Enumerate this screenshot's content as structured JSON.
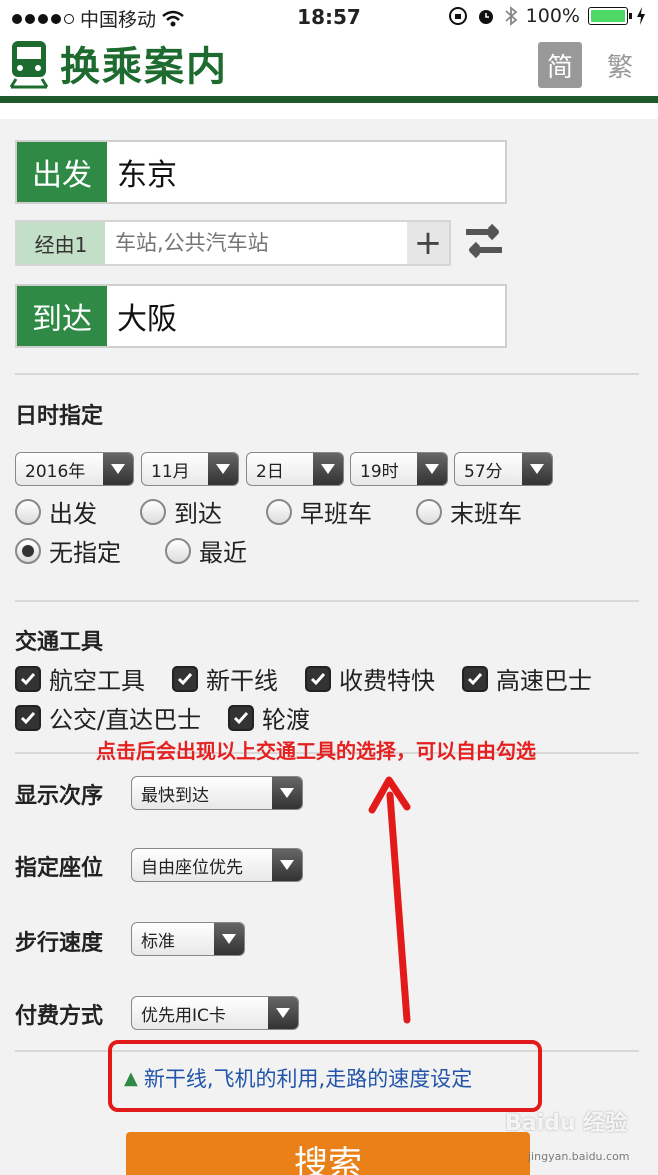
{
  "status_bar": {
    "carrier": "中国移动",
    "time": "18:57",
    "battery": "100%"
  },
  "header": {
    "title": "换乘案内",
    "lang_simplified": "简",
    "lang_traditional": "繁"
  },
  "route": {
    "from_label": "出发",
    "from_value": "东京",
    "via_label": "经由1",
    "via_placeholder": "车站,公共汽车站",
    "via_add": "+",
    "to_label": "到达",
    "to_value": "大阪"
  },
  "datetime": {
    "title": "日时指定",
    "year": "2016年",
    "month": "11月",
    "day": "2日",
    "hour": "19时",
    "minute": "57分",
    "options": [
      "出发",
      "到达",
      "早班车",
      "末班车",
      "无指定",
      "最近"
    ],
    "selected": "无指定"
  },
  "transport": {
    "title": "交通工具",
    "items": [
      "航空工具",
      "新干线",
      "收费特快",
      "高速巴士",
      "公交/直达巴士",
      "轮渡"
    ],
    "checked": [
      true,
      true,
      true,
      true,
      true,
      true
    ]
  },
  "annotation": "点击后会出现以上交通工具的选择，可以自由勾选",
  "settings": {
    "order_label": "显示次序",
    "order_value": "最快到达",
    "seat_label": "指定座位",
    "seat_value": "自由座位优先",
    "walk_label": "步行速度",
    "walk_value": "标准",
    "fare_label": "付费方式",
    "fare_value": "优先用IC卡"
  },
  "toggle_link": "新干线,飞机的利用,走路的速度设定",
  "search_button": "搜索",
  "watermark": "Baidu 经验",
  "watermark_sub": "jingyan.baidu.com",
  "colors": {
    "brand_green": "#2f8a45",
    "header_title": "#1e6b2f",
    "annotation_red": "#e52020",
    "search_orange": "#e98018",
    "link_blue": "#2255aa"
  }
}
